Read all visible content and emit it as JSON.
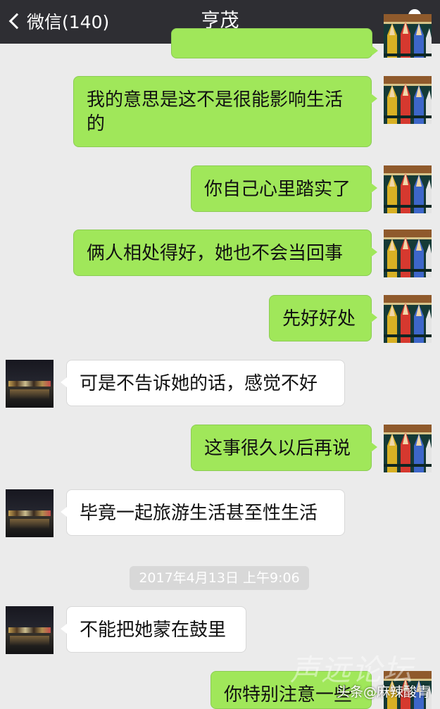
{
  "navbar": {
    "back_label": "微信(140)",
    "title": "亨茂"
  },
  "messages": [
    {
      "side": "self",
      "text": ""
    },
    {
      "side": "self",
      "text": "我的意思是这不是很能影响生活的"
    },
    {
      "side": "self",
      "text": "你自己心里踏实了"
    },
    {
      "side": "self",
      "text": "俩人相处得好，她也不会当回事"
    },
    {
      "side": "self",
      "text": "先好好处"
    },
    {
      "side": "other",
      "text": "可是不告诉她的话，感觉不好"
    },
    {
      "side": "self",
      "text": "这事很久以后再说"
    },
    {
      "side": "other",
      "text": "毕竟一起旅游生活甚至性生活"
    },
    {
      "side": "other",
      "text": "不能把她蒙在鼓里"
    },
    {
      "side": "self",
      "text": "你特别注意一些"
    }
  ],
  "timestamp": "2017年4月13日 上午9:06",
  "watermark": {
    "forum": "声远论坛",
    "source": "头条@麻辣酸青"
  },
  "colors": {
    "navbar": "#2e2e33",
    "background": "#ebebeb",
    "self_bubble": "#a0e75a",
    "other_bubble": "#ffffff"
  },
  "icons": {
    "back": "chevron-left-icon",
    "profile": "person-icon"
  }
}
